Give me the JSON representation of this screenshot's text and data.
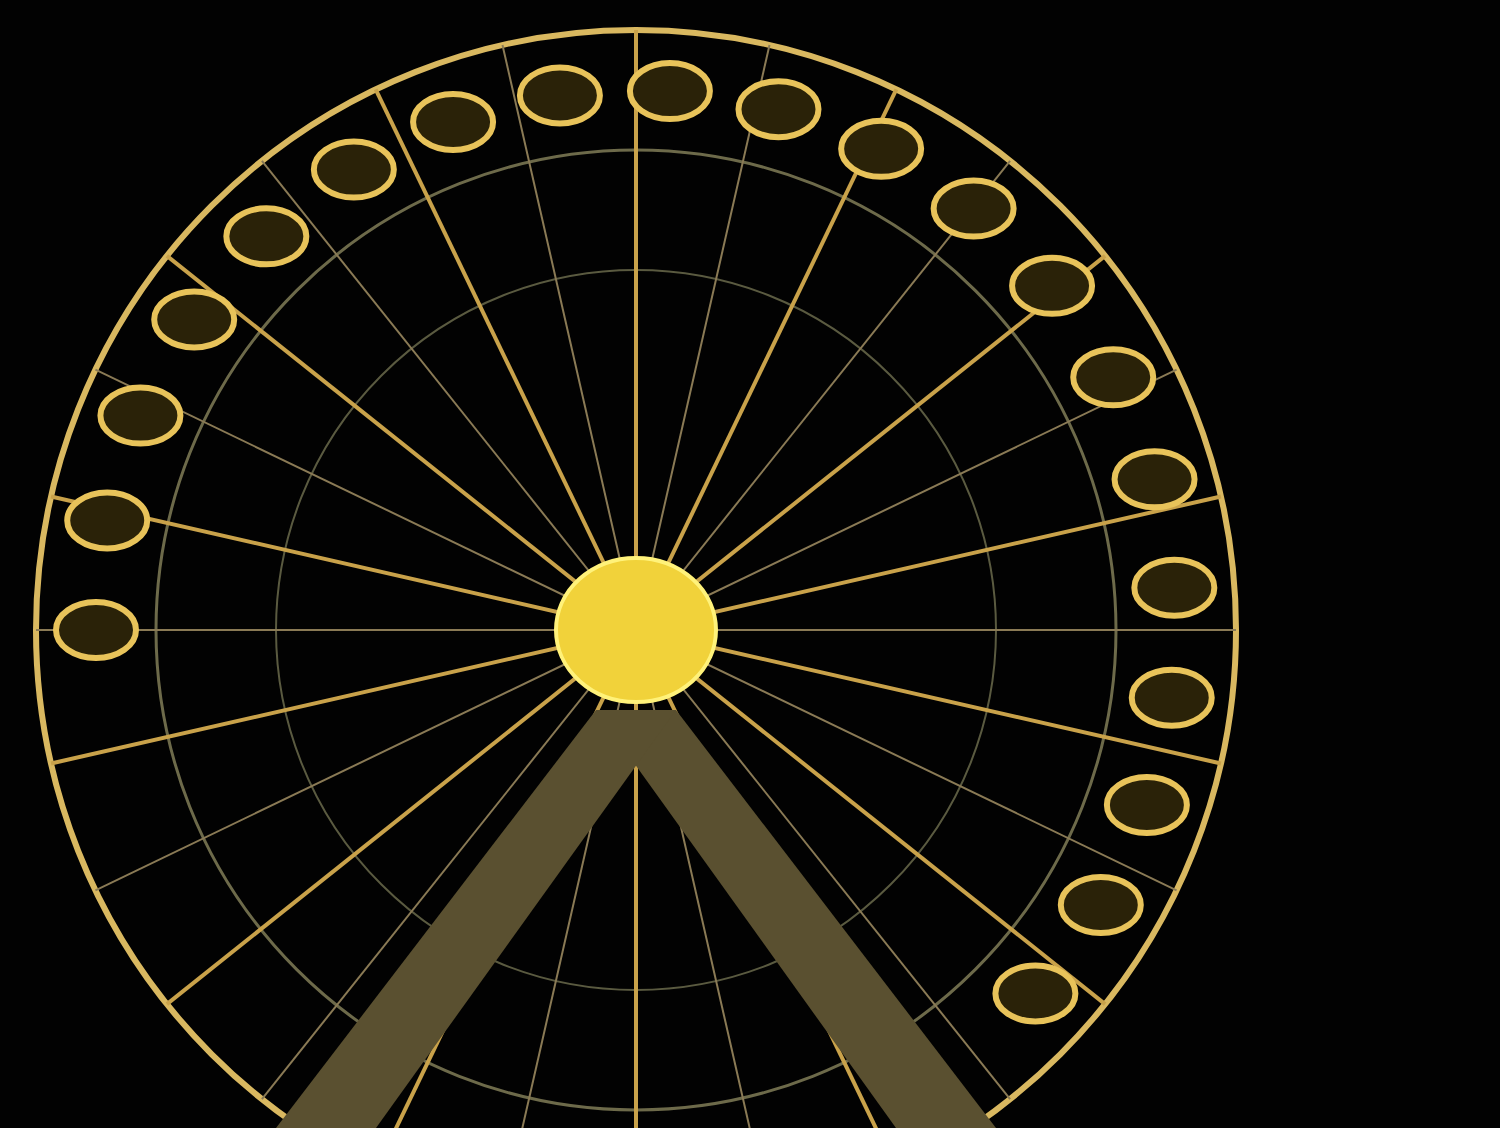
{
  "photo": {
    "kind": "ferris-wheel"
  }
}
